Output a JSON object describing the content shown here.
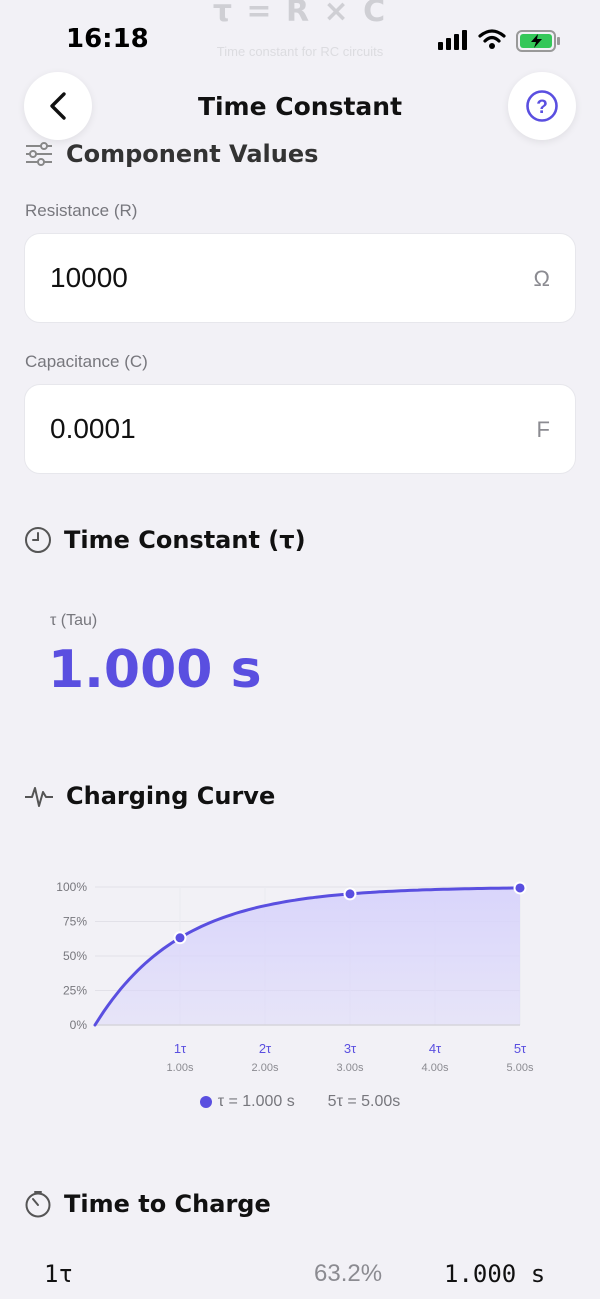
{
  "status": {
    "time": "16:18"
  },
  "ghost_header": {
    "formula": "τ = R × C",
    "subtitle": "Time constant for RC circuits"
  },
  "nav": {
    "title": "Time Constant"
  },
  "components": {
    "title": "Component Values",
    "resistance": {
      "label": "Resistance (R)",
      "value": "10000",
      "unit": "Ω"
    },
    "capacitance": {
      "label": "Capacitance (C)",
      "value": "0.0001",
      "unit": "F"
    }
  },
  "time_constant": {
    "title": "Time Constant (τ)",
    "tau_label": "τ (Tau)",
    "tau_value": "1.000 s"
  },
  "charging_curve": {
    "title": "Charging Curve"
  },
  "chart_data": {
    "type": "area",
    "x": [
      0,
      1,
      2,
      3,
      4,
      5
    ],
    "x_unit": "τ",
    "y_unit": "%",
    "marked_points": [
      {
        "x": 1,
        "y": 63.2
      },
      {
        "x": 3,
        "y": 95.0
      },
      {
        "x": 5,
        "y": 99.3
      }
    ],
    "ylim": [
      0,
      100
    ],
    "yticks": [
      "0%",
      "25%",
      "50%",
      "75%",
      "100%"
    ],
    "xticks": [
      "1τ",
      "2τ",
      "3τ",
      "4τ",
      "5τ"
    ],
    "xticks_sub": [
      "1.00s",
      "2.00s",
      "3.00s",
      "4.00s",
      "5.00s"
    ],
    "legend": [
      "τ = 1.000 s",
      "5τ = 5.00s"
    ],
    "accent": "#5a4fe0",
    "fill": "#d9d5fb"
  },
  "time_to_charge": {
    "title": "Time to Charge",
    "rows": [
      {
        "n": "1τ",
        "percent": "63.2%",
        "time": "1.000 s"
      }
    ]
  }
}
